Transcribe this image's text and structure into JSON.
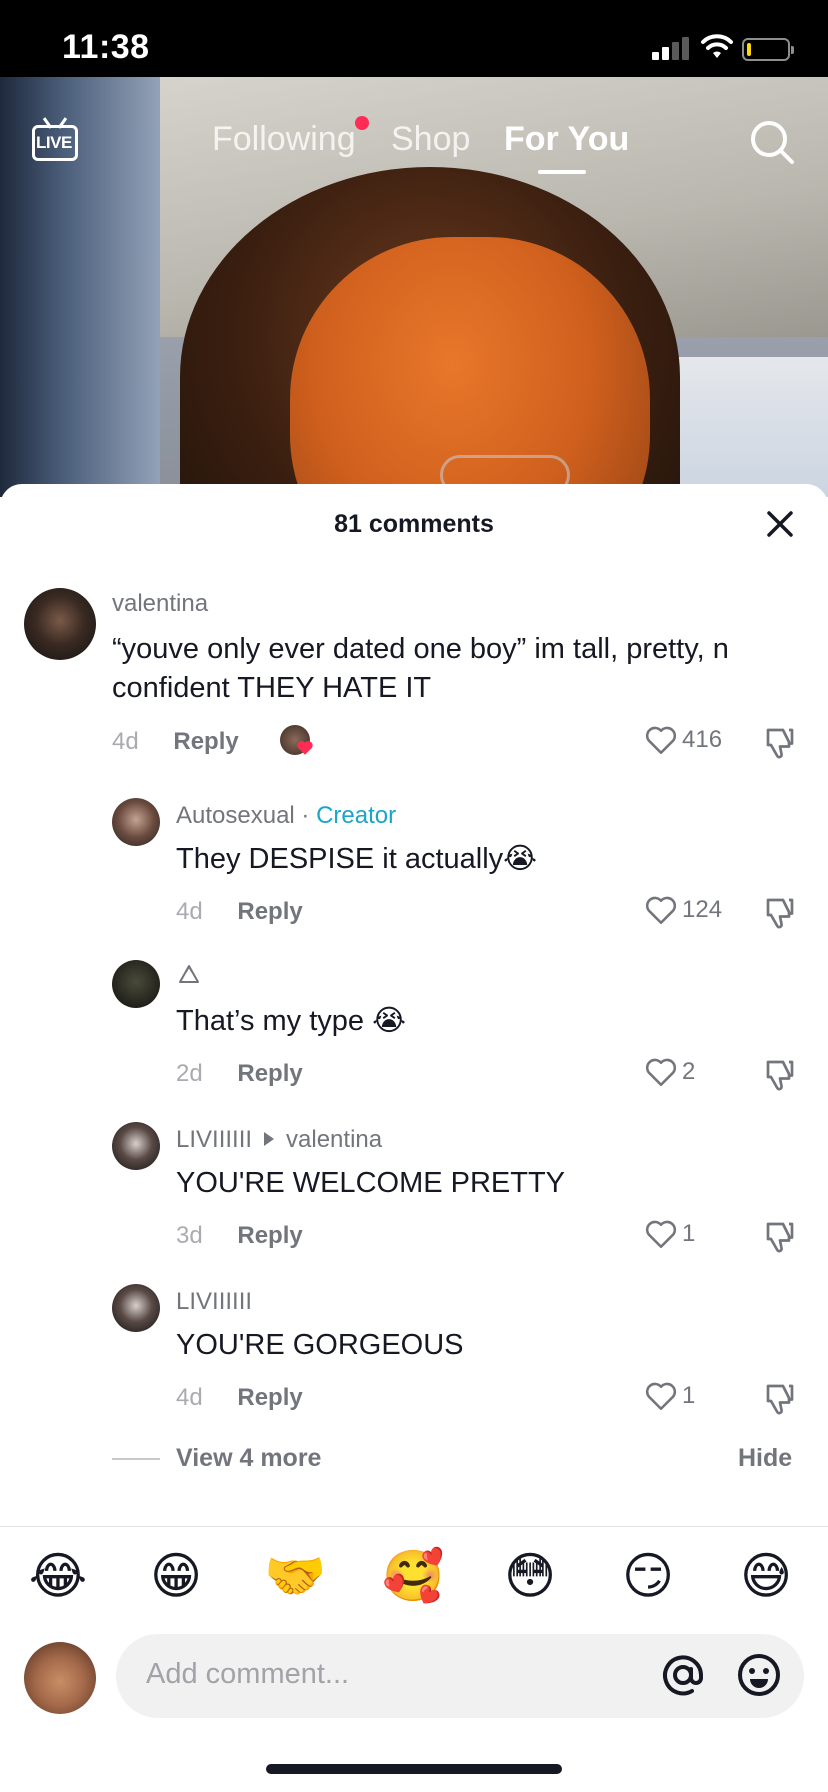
{
  "status_bar": {
    "time": "11:38"
  },
  "top_nav": {
    "live_label": "LIVE",
    "tabs": [
      {
        "label": "Following"
      },
      {
        "label": "Shop"
      },
      {
        "label": "For You"
      }
    ]
  },
  "sheet": {
    "title": "81 comments",
    "comments": [
      {
        "username": "valentina",
        "text": "“youve only ever dated one boy” im tall, pretty, n confident THEY HATE IT",
        "age": "4d",
        "reply": "Reply",
        "likes": "416"
      },
      {
        "username": "Autosexual",
        "separator": " · ",
        "badge": "Creator",
        "text": "They DESPISE it actually😭",
        "age": "4d",
        "reply": "Reply",
        "likes": "124"
      },
      {
        "username": "",
        "text": "That’s my type 😭",
        "age": "2d",
        "reply": "Reply",
        "likes": "2"
      },
      {
        "username": "LIVIIIIII",
        "reply_to": "valentina",
        "text": "YOU'RE WELCOME PRETTY",
        "age": "3d",
        "reply": "Reply",
        "likes": "1"
      },
      {
        "username": "LIVIIIIII",
        "text": "YOU'RE GORGEOUS",
        "age": "4d",
        "reply": "Reply",
        "likes": "1"
      }
    ],
    "view_more": "View 4 more",
    "hide": "Hide"
  },
  "emoji_bar": [
    "😂",
    "😁",
    "🤝",
    "🥰",
    "😳",
    "😏",
    "😅"
  ],
  "composer": {
    "placeholder": "Add comment..."
  },
  "colors": {
    "accent_red": "#fe2c55",
    "creator_blue": "#1aa6c6",
    "text_primary": "#161823",
    "text_secondary": "#73757c"
  }
}
